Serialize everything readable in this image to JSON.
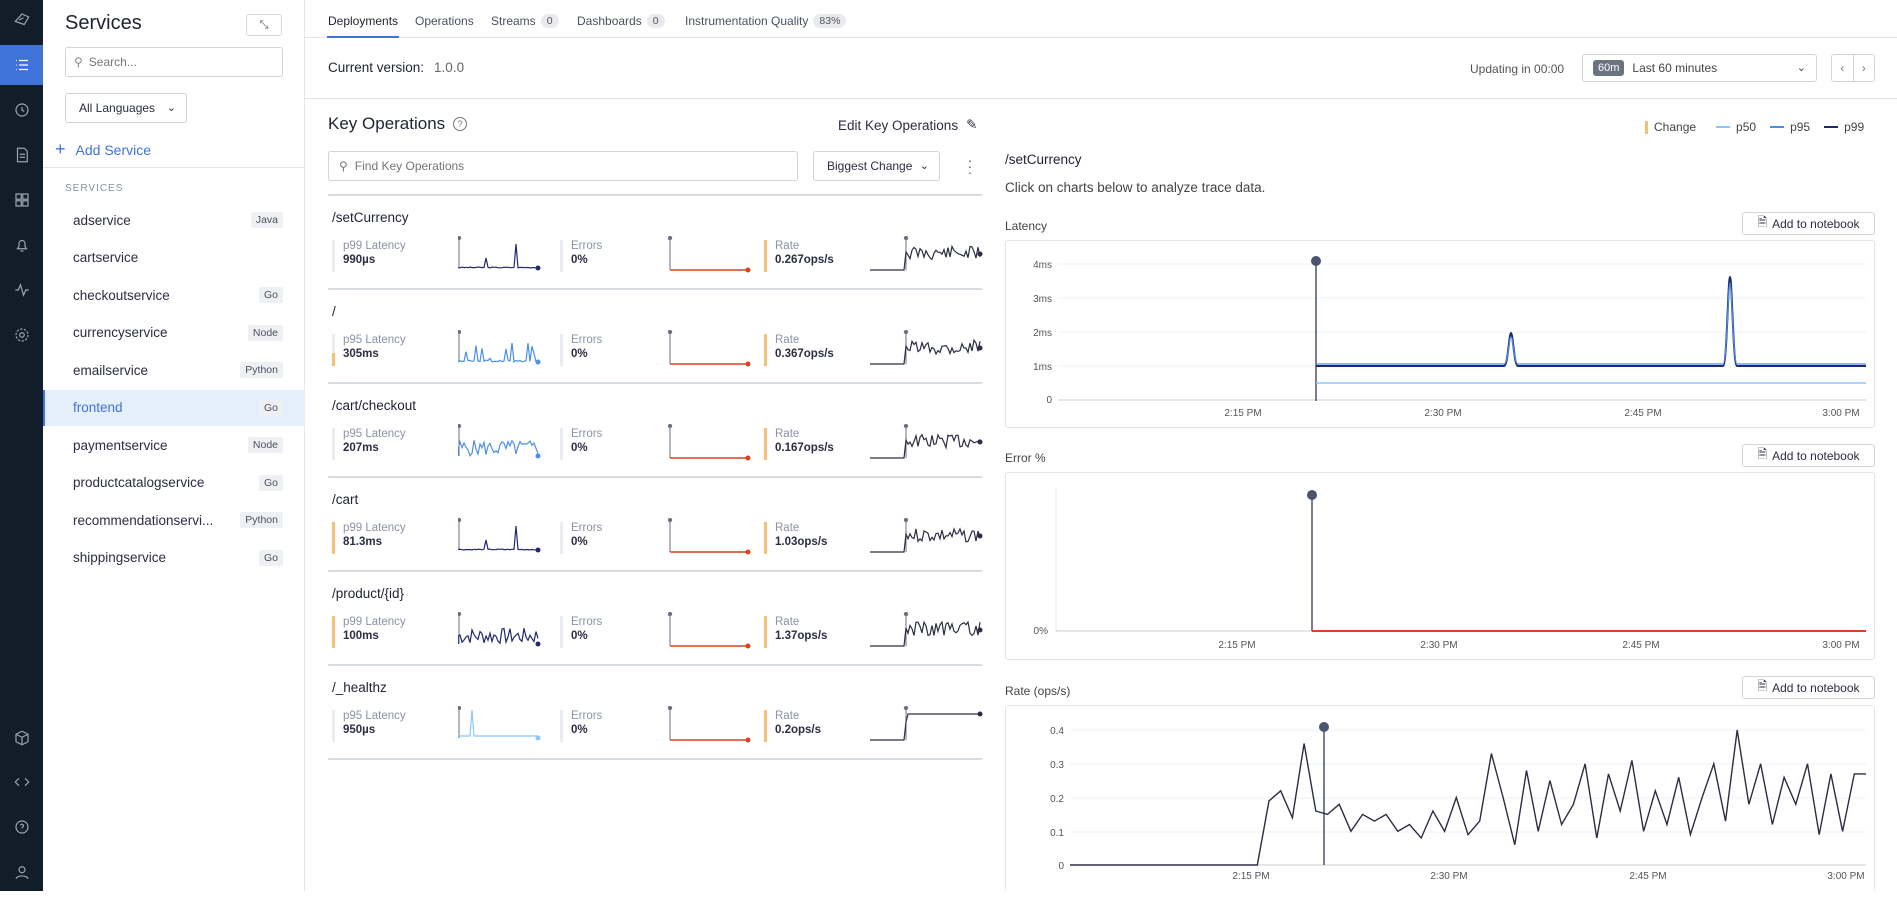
{
  "nav": {
    "icons": [
      "logo-icon",
      "services-icon",
      "clock-icon",
      "document-icon",
      "dashboards-icon",
      "bell-icon",
      "activity-icon",
      "settings-icon",
      "cube-icon",
      "code-icon",
      "help-icon",
      "user-icon"
    ]
  },
  "sidebar": {
    "title": "Services",
    "search_placeholder": "Search...",
    "language_filter": "All Languages",
    "add_service": "Add Service",
    "section_label": "SERVICES",
    "items": [
      {
        "name": "adservice",
        "tag": "Java"
      },
      {
        "name": "cartservice",
        "tag": ""
      },
      {
        "name": "checkoutservice",
        "tag": "Go"
      },
      {
        "name": "currencyservice",
        "tag": "Node"
      },
      {
        "name": "emailservice",
        "tag": "Python"
      },
      {
        "name": "frontend",
        "tag": "Go"
      },
      {
        "name": "paymentservice",
        "tag": "Node"
      },
      {
        "name": "productcatalogservice",
        "tag": "Go"
      },
      {
        "name": "recommendationservi...",
        "tag": "Python"
      },
      {
        "name": "shippingservice",
        "tag": "Go"
      }
    ]
  },
  "tabs": [
    {
      "label": "Deployments",
      "count": ""
    },
    {
      "label": "Operations",
      "count": ""
    },
    {
      "label": "Streams",
      "count": "0"
    },
    {
      "label": "Dashboards",
      "count": "0"
    },
    {
      "label": "Instrumentation Quality",
      "count": "83%"
    }
  ],
  "version": {
    "label": "Current version:",
    "value": "1.0.0"
  },
  "updating": "Updating in 00:00",
  "range": {
    "badge": "60m",
    "label": "Last 60 minutes"
  },
  "key_ops": {
    "title": "Key Operations",
    "edit_label": "Edit Key Operations",
    "search_placeholder": "Find Key Operations",
    "sort_label": "Biggest Change",
    "latency_label_p99": "p99 Latency",
    "latency_label_p95": "p95 Latency",
    "errors_label": "Errors",
    "rate_label": "Rate",
    "rows": [
      {
        "name": "/setCurrency",
        "lat_label": "p99 Latency",
        "latency": "990µs",
        "errors": "0%",
        "rate": "0.267ops/s"
      },
      {
        "name": "/",
        "lat_label": "p95 Latency",
        "latency": "305ms",
        "errors": "0%",
        "rate": "0.367ops/s"
      },
      {
        "name": "/cart/checkout",
        "lat_label": "p95 Latency",
        "latency": "207ms",
        "errors": "0%",
        "rate": "0.167ops/s"
      },
      {
        "name": "/cart",
        "lat_label": "p99 Latency",
        "latency": "81.3ms",
        "errors": "0%",
        "rate": "1.03ops/s"
      },
      {
        "name": "/product/{id}",
        "lat_label": "p99 Latency",
        "latency": "100ms",
        "errors": "0%",
        "rate": "1.37ops/s"
      },
      {
        "name": "/_healthz",
        "lat_label": "p95 Latency",
        "latency": "950µs",
        "errors": "0%",
        "rate": "0.2ops/s"
      }
    ]
  },
  "legend": {
    "change": "Change",
    "p50": "p50",
    "p95": "p95",
    "p99": "p99",
    "colors": {
      "change": "#f3c07a",
      "p50": "#8ec5f5",
      "p95": "#4d8fe8",
      "p99": "#1f2a6e"
    }
  },
  "detail": {
    "operation": "/setCurrency",
    "hint": "Click on charts below to analyze trace data.",
    "add_to_notebook": "Add to notebook"
  },
  "chart_data": [
    {
      "type": "line",
      "title": "Latency",
      "x": [
        "2:15 PM",
        "2:30 PM",
        "2:45 PM",
        "3:00 PM"
      ],
      "yticks": [
        "0",
        "1ms",
        "2ms",
        "3ms",
        "4ms"
      ],
      "ylim": [
        0,
        4.3
      ],
      "series": [
        {
          "name": "p99",
          "values_ms": "~1 steady after 2:22 PM, spikes to ~2.2ms at 2:35 PM and ~3.7ms at 2:52 PM"
        },
        {
          "name": "p50",
          "values_ms": "~0.5 steady after 2:22 PM"
        }
      ]
    },
    {
      "type": "line",
      "title": "Error %",
      "x": [
        "2:15 PM",
        "2:30 PM",
        "2:45 PM",
        "3:00 PM"
      ],
      "yticks": [
        "0%"
      ],
      "series": [
        {
          "name": "errors",
          "value": 0
        }
      ]
    },
    {
      "type": "line",
      "title": "Rate (ops/s)",
      "x": [
        "2:15 PM",
        "2:30 PM",
        "2:45 PM",
        "3:00 PM"
      ],
      "yticks": [
        "0",
        "0.1",
        "0.2",
        "0.3",
        "0.4"
      ],
      "ylim": [
        0,
        0.42
      ],
      "series": [
        {
          "name": "rate",
          "values": [
            0,
            0,
            0,
            0,
            0,
            0,
            0,
            0,
            0,
            0,
            0,
            0,
            0,
            0,
            0,
            0,
            0,
            0.19,
            0.22,
            0.14,
            0.36,
            0.16,
            0.15,
            0.18,
            0.1,
            0.15,
            0.13,
            0.15,
            0.1,
            0.12,
            0.08,
            0.16,
            0.1,
            0.2,
            0.09,
            0.13,
            0.33,
            0.2,
            0.06,
            0.28,
            0.1,
            0.25,
            0.12,
            0.18,
            0.3,
            0.08,
            0.27,
            0.16,
            0.31,
            0.1,
            0.22,
            0.12,
            0.26,
            0.09,
            0.2,
            0.3,
            0.13,
            0.4,
            0.18,
            0.3,
            0.12,
            0.26,
            0.18,
            0.3,
            0.09,
            0.27,
            0.1,
            0.27,
            0.27
          ]
        }
      ]
    }
  ]
}
